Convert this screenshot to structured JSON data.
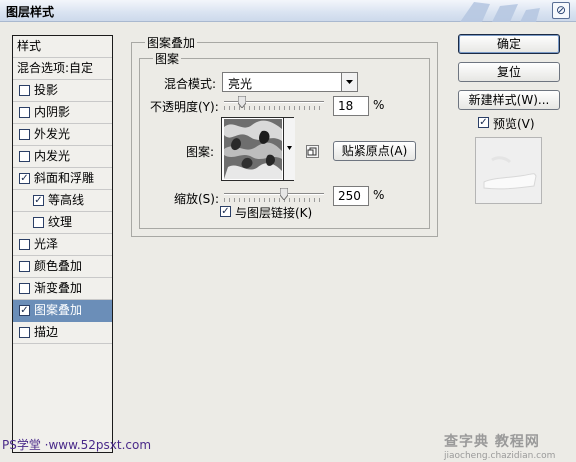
{
  "window": {
    "title": "图层样式",
    "close_glyph": "⊘"
  },
  "styles_panel": {
    "header": "样式",
    "items": [
      {
        "label": "混合选项:自定",
        "checkbox": false,
        "checked": false,
        "indent": false,
        "selected": false
      },
      {
        "label": "投影",
        "checkbox": true,
        "checked": false,
        "indent": false,
        "selected": false
      },
      {
        "label": "内阴影",
        "checkbox": true,
        "checked": false,
        "indent": false,
        "selected": false
      },
      {
        "label": "外发光",
        "checkbox": true,
        "checked": false,
        "indent": false,
        "selected": false
      },
      {
        "label": "内发光",
        "checkbox": true,
        "checked": false,
        "indent": false,
        "selected": false
      },
      {
        "label": "斜面和浮雕",
        "checkbox": true,
        "checked": true,
        "indent": false,
        "selected": false
      },
      {
        "label": "等高线",
        "checkbox": true,
        "checked": true,
        "indent": true,
        "selected": false
      },
      {
        "label": "纹理",
        "checkbox": true,
        "checked": false,
        "indent": true,
        "selected": false
      },
      {
        "label": "光泽",
        "checkbox": true,
        "checked": false,
        "indent": false,
        "selected": false
      },
      {
        "label": "颜色叠加",
        "checkbox": true,
        "checked": false,
        "indent": false,
        "selected": false
      },
      {
        "label": "渐变叠加",
        "checkbox": true,
        "checked": false,
        "indent": false,
        "selected": false
      },
      {
        "label": "图案叠加",
        "checkbox": true,
        "checked": true,
        "indent": false,
        "selected": true
      },
      {
        "label": "描边",
        "checkbox": true,
        "checked": false,
        "indent": false,
        "selected": false
      }
    ]
  },
  "pattern_overlay": {
    "section_title": "图案叠加",
    "group_title": "图案",
    "blend_mode_label": "混合模式:",
    "blend_mode_value": "亮光",
    "opacity_label": "不透明度(Y):",
    "opacity_value": "18",
    "opacity_level": 0.18,
    "percent": "%",
    "pattern_label": "图案:",
    "snap_origin_button": "贴紧原点(A)",
    "scale_label": "缩放(S):",
    "scale_value": "250",
    "scale_level": 0.25,
    "link_label": "与图层链接(K)",
    "link_checked": true
  },
  "right_buttons": {
    "ok": "确定",
    "reset": "复位",
    "new_style": "新建样式(W)...",
    "preview_label": "预览(V)",
    "preview_checked": true
  },
  "watermarks": {
    "left": "PS学堂 ·www.52psxt.com",
    "right_top": "查字典 教程网",
    "right_bottom": "jiaocheng.chazidian.com"
  },
  "colors": {
    "selected_row": "#6b8eb8",
    "title_bar": "#d9e3f1",
    "background": "#ecebe6"
  }
}
